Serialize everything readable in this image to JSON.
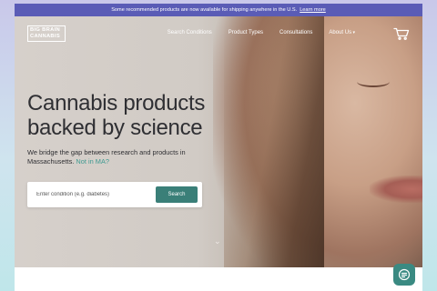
{
  "announcement": {
    "text": "Some recommended products are now available for shipping anywhere in the U.S.",
    "link": "Learn more"
  },
  "logo": {
    "line1": "BIG BRAIN",
    "line2": "CANNABIS"
  },
  "nav": {
    "items": [
      {
        "label": "Search Conditions"
      },
      {
        "label": "Product Types"
      },
      {
        "label": "Consultations"
      },
      {
        "label": "About Us"
      }
    ],
    "cart_icon": "cart-icon"
  },
  "hero": {
    "headline_line1": "Cannabis products",
    "headline_line2": "backed by science",
    "sub_text": "We bridge the gap between research and products in Massachusetts.",
    "sub_link": "Not in MA?"
  },
  "search": {
    "placeholder": "Enter condition (e.g. diabetes)",
    "button_label": "Search"
  },
  "colors": {
    "announcement_bg": "#5a5cb6",
    "accent": "#3f9a91",
    "button": "#3a7f78",
    "text": "#2f2f33"
  },
  "icons": {
    "scroll": "chevron-down-icon",
    "chat": "chat-icon"
  }
}
